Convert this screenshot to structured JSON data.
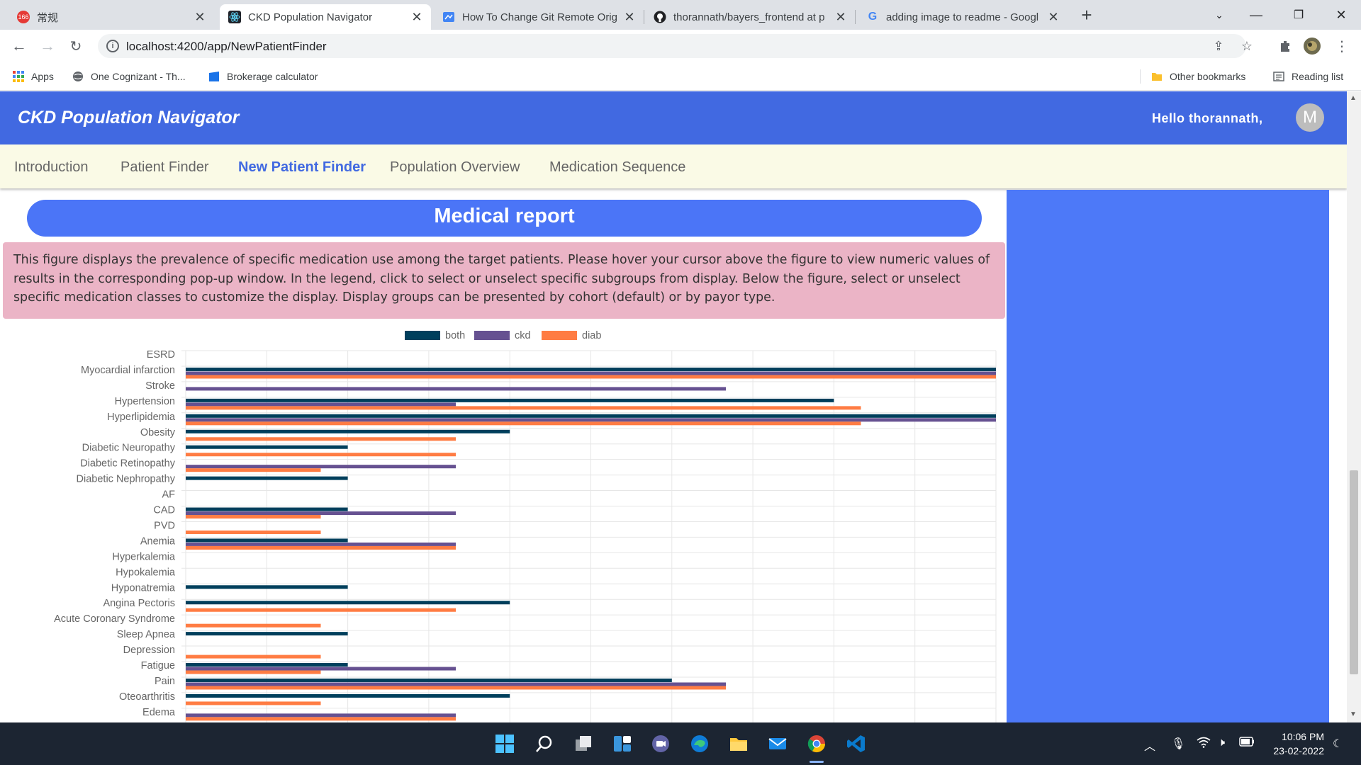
{
  "browser": {
    "tabs": [
      {
        "title": "常规",
        "icon": "badge-166-icon",
        "badge": "166",
        "active": false
      },
      {
        "title": "CKD Population Navigator",
        "icon": "react-icon",
        "active": true
      },
      {
        "title": "How To Change Git Remote Orig",
        "icon": "document-icon",
        "active": false
      },
      {
        "title": "thorannath/bayers_frontend at p",
        "icon": "github-icon",
        "active": false
      },
      {
        "title": "adding image to readme - Googl",
        "icon": "google-icon",
        "active": false
      }
    ],
    "url": "localhost:4200/app/NewPatientFinder",
    "bookmarks": [
      {
        "label": "Apps",
        "icon": "apps-grid-icon"
      },
      {
        "label": "One Cognizant - Th...",
        "icon": "globe-icon"
      },
      {
        "label": "Brokerage calculator",
        "icon": "bookmark-doc-icon"
      }
    ],
    "other_bookmarks": "Other bookmarks",
    "reading_list": "Reading list"
  },
  "app": {
    "title": "CKD Population Navigator",
    "greeting": "Hello thorannath,",
    "avatar_letter": "M",
    "nav": [
      {
        "label": "Introduction",
        "active": false
      },
      {
        "label": "Patient Finder",
        "active": false
      },
      {
        "label": "New Patient Finder",
        "active": true
      },
      {
        "label": "Population Overview",
        "active": false
      },
      {
        "label": "Medication Sequence",
        "active": false
      }
    ],
    "report_title": "Medical report",
    "description": "This figure displays the prevalence of specific medication use among the target patients. Please hover your cursor above the figure to view numeric values of results in the corresponding pop-up window. In the legend, click to select or unselect specific subgroups from display. Below the figure, select or unselect specific medication classes to customize the display. Display groups can be presented by cohort (default) or by payor type.",
    "colors": {
      "header": "#4169e1",
      "both": "#003f5c",
      "ckd": "#665191",
      "diab": "#ff7c43"
    }
  },
  "chart_data": {
    "type": "bar",
    "orientation": "horizontal",
    "categories": [
      "ESRD",
      "Myocardial infarction",
      "Stroke",
      "Hypertension",
      "Hyperlipidemia",
      "Obesity",
      "Diabetic Neuropathy",
      "Diabetic Retinopathy",
      "Diabetic Nephropathy",
      "AF",
      "CAD",
      "PVD",
      "Anemia",
      "Hyperkalemia",
      "Hypokalemia",
      "Hyponatremia",
      "Angina Pectoris",
      "Acute Coronary Syndrome",
      "Sleep Apnea",
      "Depression",
      "Fatigue",
      "Pain",
      "Oteoarthritis",
      "Edema"
    ],
    "series": [
      {
        "name": "both",
        "color": "#003f5c",
        "values": [
          0,
          30,
          0,
          24,
          30,
          12,
          6,
          0,
          6,
          0,
          6,
          0,
          6,
          0,
          0,
          6,
          12,
          0,
          6,
          0,
          6,
          18,
          12,
          0
        ]
      },
      {
        "name": "ckd",
        "color": "#665191",
        "values": [
          0,
          30,
          20,
          10,
          30,
          0,
          0,
          10,
          0,
          0,
          10,
          0,
          10,
          0,
          0,
          0,
          0,
          0,
          0,
          0,
          10,
          20,
          0,
          10
        ]
      },
      {
        "name": "diab",
        "color": "#ff7c43",
        "values": [
          0,
          30,
          0,
          25,
          25,
          10,
          10,
          5,
          0,
          0,
          5,
          5,
          10,
          0,
          0,
          0,
          10,
          5,
          0,
          5,
          5,
          20,
          5,
          10
        ]
      }
    ],
    "xlim": [
      0,
      30
    ],
    "grid": true,
    "legend": "top-center"
  },
  "taskbar": {
    "apps": [
      "windows-start-icon",
      "search-icon",
      "task-view-icon",
      "widgets-icon",
      "teams-chat-icon",
      "edge-icon",
      "file-explorer-icon",
      "mail-icon",
      "chrome-icon",
      "vscode-icon"
    ],
    "time": "10:06 PM",
    "date": "23-02-2022"
  }
}
